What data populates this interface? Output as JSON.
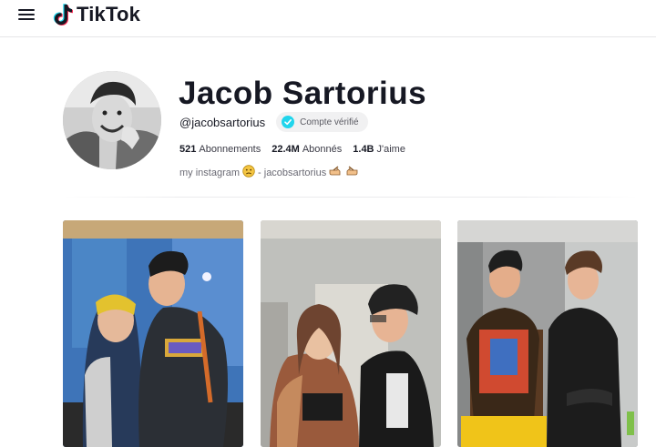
{
  "header": {
    "logo_text": "TikTok",
    "menu_icon": "hamburger-menu-icon",
    "logo_icon": "tiktok-note-icon"
  },
  "profile": {
    "name": "Jacob Sartorius",
    "handle": "@jacobsartorius",
    "verified_label": "Compte vérifié",
    "stats": {
      "following_count": "521",
      "following_label": "Abonnements",
      "followers_count": "22.4M",
      "followers_label": "Abonnés",
      "likes_count": "1.4B",
      "likes_label": "J'aime"
    },
    "bio": {
      "text_before": "my instagram",
      "text_after": "- jacobsartorius"
    }
  },
  "colors": {
    "verified_badge": "#20d5ec",
    "text_primary": "#161823",
    "text_secondary": "#6a6a74"
  }
}
